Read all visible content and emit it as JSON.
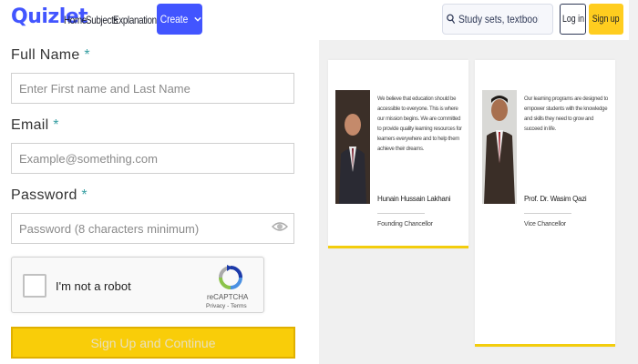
{
  "header": {
    "logo": "Quizlet",
    "nav": [
      "Home",
      "Subjects",
      "Explanations"
    ],
    "create_label": "Create",
    "search_placeholder": "Study sets, textbooks, ...",
    "login_label": "Log in",
    "signup_label": "Sign up"
  },
  "form": {
    "full_name": {
      "label": "Full Name",
      "required": "*",
      "placeholder": "Enter First name and Last Name",
      "value": ""
    },
    "email": {
      "label": "Email",
      "required": "*",
      "placeholder": "Example@something.com",
      "value": ""
    },
    "password": {
      "label": "Password",
      "required": "*",
      "placeholder": "Password (8 characters minimum)",
      "value": ""
    },
    "captcha": {
      "label": "I'm not a robot",
      "brand": "reCAPTCHA",
      "terms": "Privacy - Terms"
    },
    "submit_label": "Sign Up and Continue"
  },
  "testimonials": [
    {
      "quote": "We believe that education should be accessible to everyone. This is where our mission begins. We are committed to provide quality learning resources for learners everywhere and to help them achieve their dreams.",
      "name": "Hunain Hussain Lakhani",
      "role": "Founding Chancellor"
    },
    {
      "quote": "Our learning programs are designed to empower students with the knowledge and skills they need to grow and succeed in life.",
      "name": "Prof. Dr. Wasim Qazi",
      "role": "Vice Chancellor"
    }
  ],
  "colors": {
    "brand": "#4255ff",
    "accent_yellow": "#ffcd1f",
    "required_mark": "#3aa0a4"
  }
}
